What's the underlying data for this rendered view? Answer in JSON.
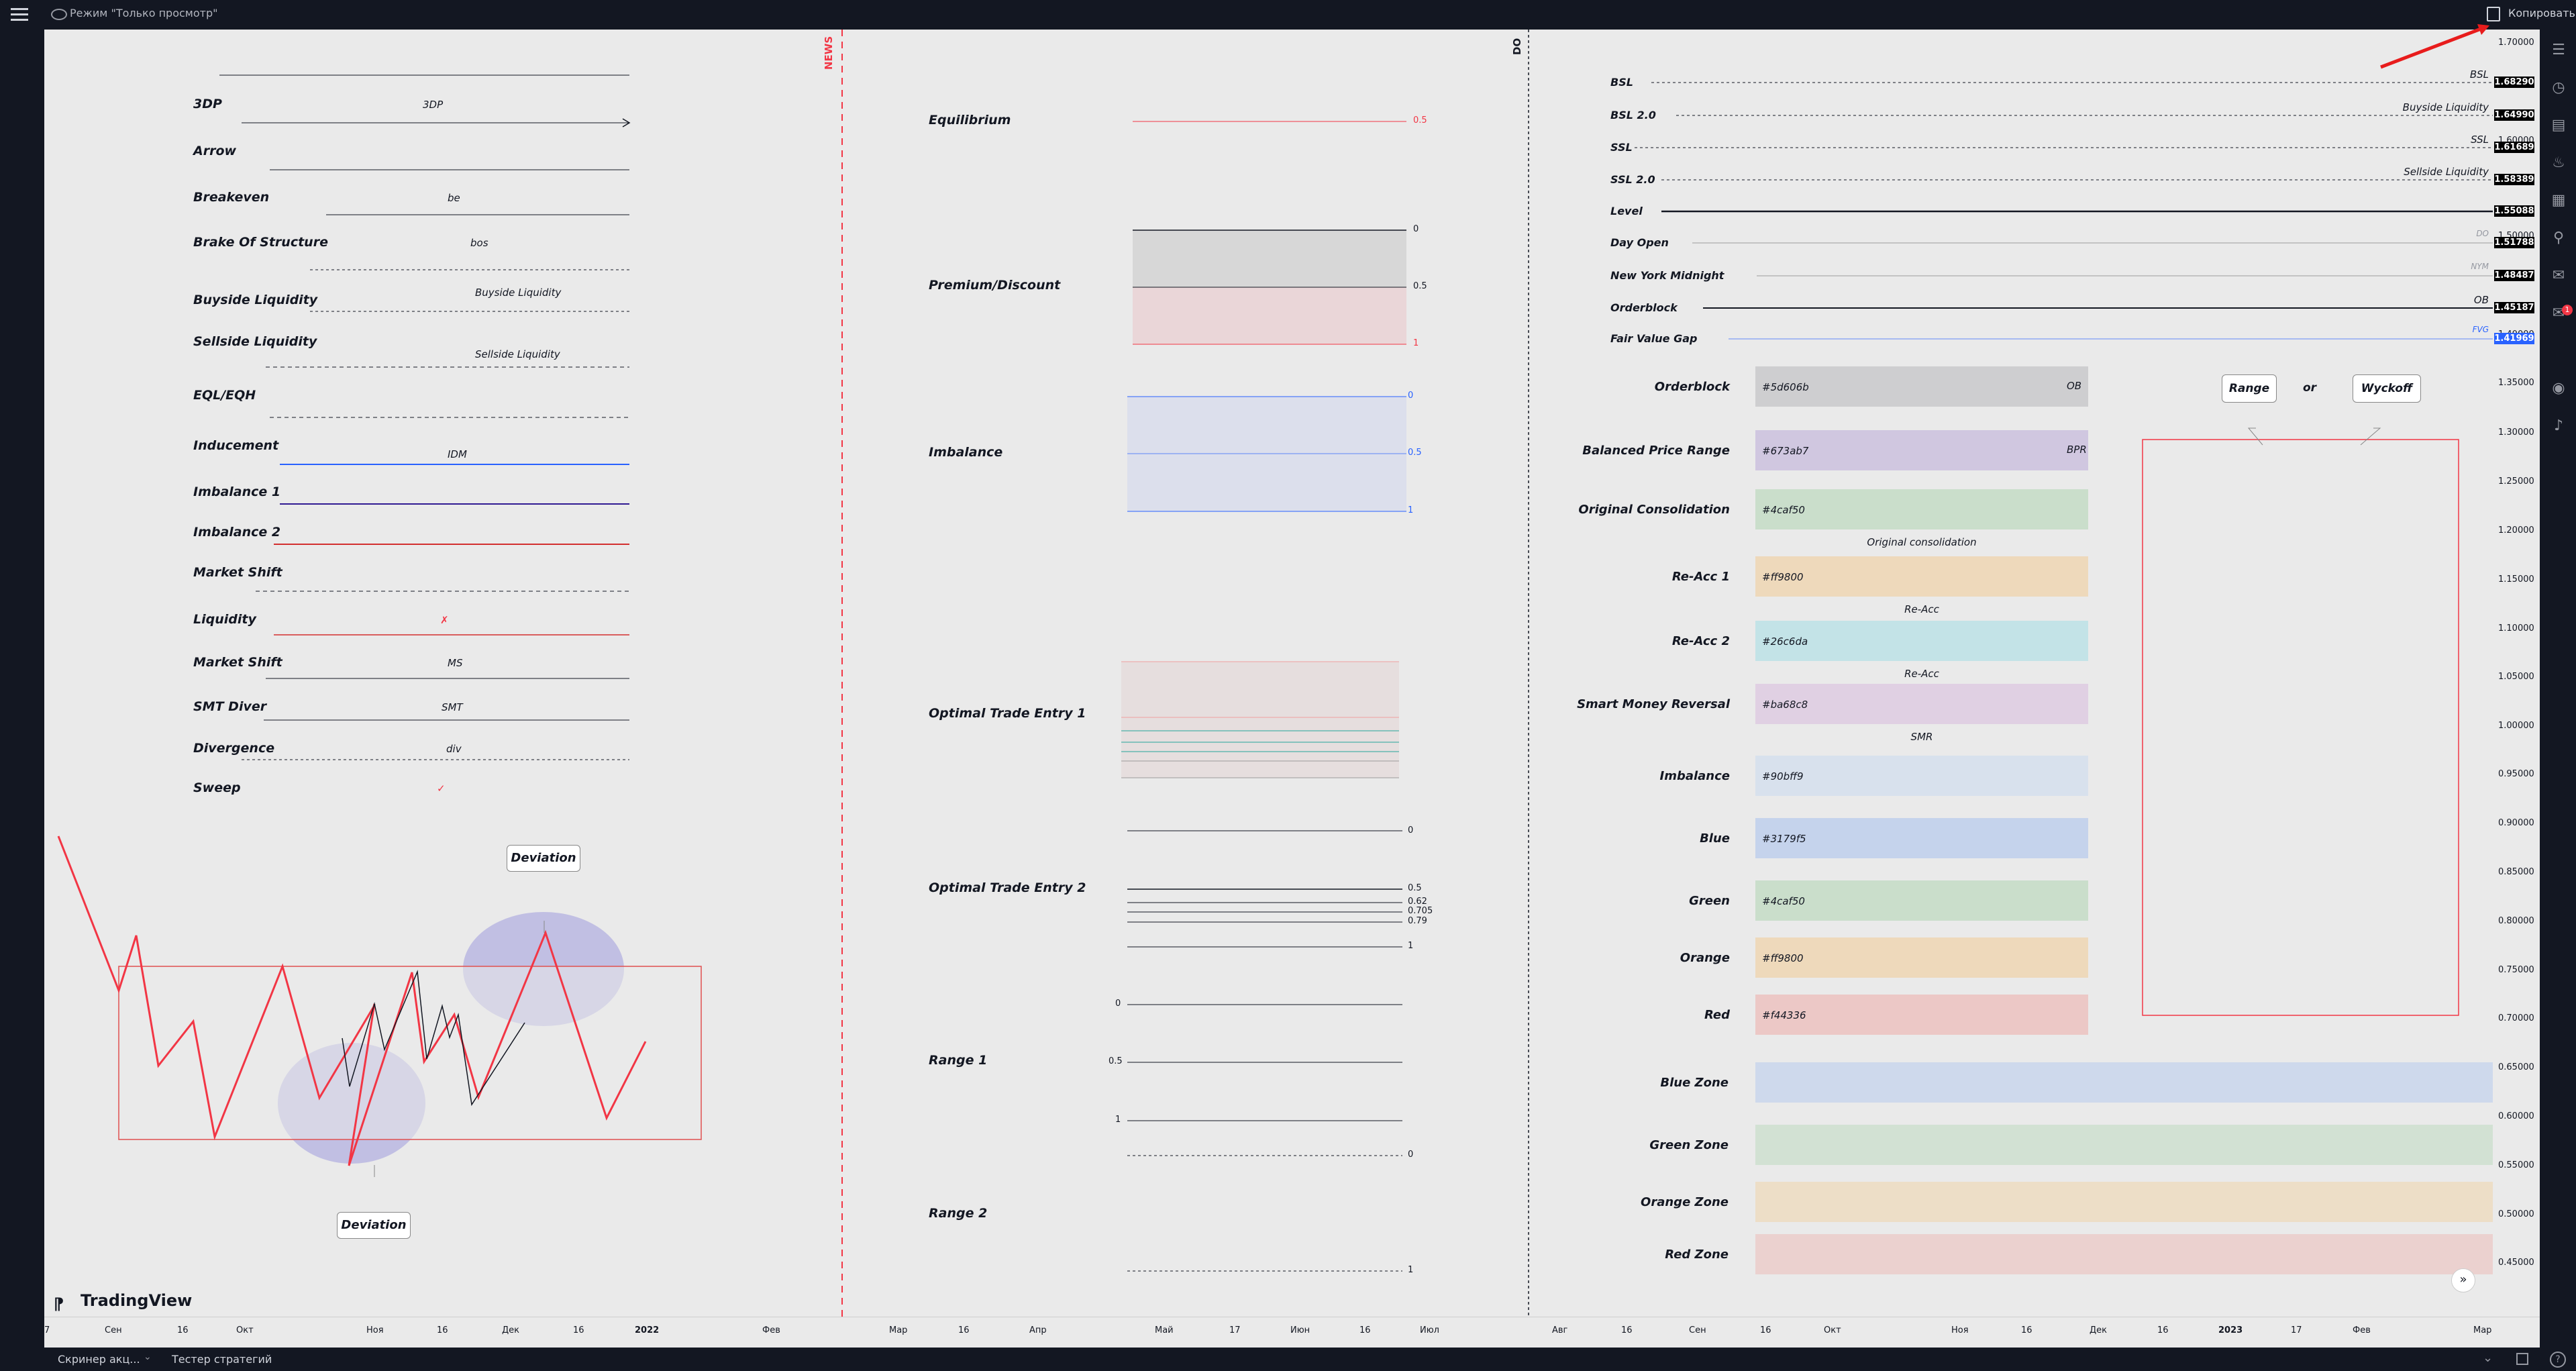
{
  "topbar": {
    "menu_icon": "hamburger-icon",
    "view_mode_icon": "eye-icon",
    "view_mode_label": "Режим \"Только просмотр\"",
    "copy_icon": "copy-icon",
    "copy_label": "Копировать"
  },
  "bottombar": {
    "screener_label": "Скринер акц...",
    "strategy_tester_label": "Тестер стратегий"
  },
  "logo": {
    "text": "TradingView"
  },
  "legend_left": [
    {
      "label": "3DP",
      "tag": "3DP"
    },
    {
      "label": "Arrow",
      "tag": ""
    },
    {
      "label": "Breakeven",
      "tag": "be"
    },
    {
      "label": "Brake Of Structure",
      "tag": "bos"
    },
    {
      "label": "Buyside Liquidity",
      "tag": "Buyside Liquidity"
    },
    {
      "label": "Sellside Liquidity",
      "tag": "Sellside Liquidity"
    },
    {
      "label": "EQL/EQH",
      "tag": ""
    },
    {
      "label": "Inducement",
      "tag": "IDM"
    },
    {
      "label": "Imbalance 1",
      "tag": ""
    },
    {
      "label": "Imbalance 2",
      "tag": ""
    },
    {
      "label": "Market Shift",
      "tag": ""
    },
    {
      "label": "Liquidity",
      "tag": "✗"
    },
    {
      "label": "Market Shift",
      "tag": "MS"
    },
    {
      "label": "SMT Diver",
      "tag": "SMT"
    },
    {
      "label": "Divergence",
      "tag": "div"
    },
    {
      "label": "Sweep",
      "tag": "✓"
    }
  ],
  "deviation": {
    "top_label": "Deviation",
    "bottom_label": "Deviation"
  },
  "vertical_markers": {
    "news": "NEWS",
    "do": "DO"
  },
  "fib_section": {
    "equilibrium": {
      "label": "Equilibrium",
      "level": "0.5"
    },
    "premium_discount": {
      "label": "Premium/Discount",
      "levels": [
        "0",
        "0.5",
        "1"
      ]
    },
    "imbalance": {
      "label": "Imbalance",
      "levels": [
        "0",
        "0.5",
        "1"
      ]
    },
    "ote1": {
      "label": "Optimal Trade Entry 1"
    },
    "ote2": {
      "label": "Optimal Trade Entry 2",
      "levels": [
        "0",
        "0.5",
        "0.62",
        "0.705",
        "0.79",
        "1"
      ]
    },
    "range1": {
      "label": "Range 1",
      "levels": [
        "0",
        "0.5",
        "1"
      ]
    },
    "range2": {
      "label": "Range 2",
      "levels": [
        "0",
        "1"
      ]
    }
  },
  "right_lines": [
    {
      "label": "BSL",
      "tag": "BSL",
      "price": "1.68290"
    },
    {
      "label": "BSL 2.0",
      "tag": "Buyside Liquidity",
      "price": "1.64990"
    },
    {
      "label": "SSL",
      "tag": "SSL",
      "price": "1.61689"
    },
    {
      "label": "SSL 2.0",
      "tag": "Sellside Liquidity",
      "price": "1.58389"
    },
    {
      "label": "Level",
      "tag": "",
      "price": "1.55088"
    },
    {
      "label": "Day Open",
      "tag": "DO",
      "price": "1.51788"
    },
    {
      "label": "New York Midnight",
      "tag": "NYM",
      "price": "1.48487"
    },
    {
      "label": "Orderblock",
      "tag": "OB",
      "price": "1.45187"
    },
    {
      "label": "Fair Value Gap",
      "tag": "FVG",
      "price": "1.41969"
    }
  ],
  "boxes": [
    {
      "label": "Orderblock",
      "hex": "#5d606b",
      "tag": "OB",
      "below": "",
      "color": "#5d606b"
    },
    {
      "label": "Balanced Price Range",
      "hex": "#673ab7",
      "tag": "BPR",
      "below": "",
      "color": "#673ab7"
    },
    {
      "label": "Original Consolidation",
      "hex": "#4caf50",
      "tag": "",
      "below": "Original consolidation",
      "color": "#4caf50"
    },
    {
      "label": "Re-Acc 1",
      "hex": "#ff9800",
      "tag": "",
      "below": "Re-Acc",
      "color": "#ff9800"
    },
    {
      "label": "Re-Acc 2",
      "hex": "#26c6da",
      "tag": "",
      "below": "Re-Acc",
      "color": "#26c6da"
    },
    {
      "label": "Smart Money Reversal",
      "hex": "#ba68c8",
      "tag": "",
      "below": "SMR",
      "color": "#ba68c8"
    },
    {
      "label": "Imbalance",
      "hex": "#90bff9",
      "tag": "",
      "below": "",
      "color": "#90bff9"
    },
    {
      "label": "Blue",
      "hex": "#3179f5",
      "tag": "",
      "below": "",
      "color": "#3179f5"
    },
    {
      "label": "Green",
      "hex": "#4caf50",
      "tag": "",
      "below": "",
      "color": "#4caf50"
    },
    {
      "label": "Orange",
      "hex": "#ff9800",
      "tag": "",
      "below": "",
      "color": "#ff9800"
    },
    {
      "label": "Red",
      "hex": "#f44336",
      "tag": "",
      "below": "",
      "color": "#f44336"
    }
  ],
  "zones": [
    {
      "label": "Blue Zone",
      "color": "#3179f5"
    },
    {
      "label": "Green Zone",
      "color": "#4caf50"
    },
    {
      "label": "Orange Zone",
      "color": "#ff9800"
    },
    {
      "label": "Red Zone",
      "color": "#f44336"
    }
  ],
  "range_wyckoff": {
    "range": "Range",
    "or": "or",
    "wyckoff": "Wyckoff"
  },
  "price_axis": [
    "1.70000",
    "1.60000",
    "1.50000",
    "1.40000",
    "1.35000",
    "1.30000",
    "1.25000",
    "1.20000",
    "1.15000",
    "1.10000",
    "1.05000",
    "1.00000",
    "0.95000",
    "0.90000",
    "0.85000",
    "0.80000",
    "0.75000",
    "0.70000",
    "0.65000",
    "0.60000",
    "0.55000",
    "0.50000",
    "0.45000"
  ],
  "time_axis": [
    "7",
    "Сен",
    "16",
    "Окт",
    "Ноя",
    "16",
    "Дек",
    "16",
    "2022",
    "Фев",
    "Мар",
    "16",
    "Апр",
    "Май",
    "17",
    "Июн",
    "16",
    "Июл",
    "Авг",
    "16",
    "Сен",
    "16",
    "Окт",
    "Ноя",
    "16",
    "Дек",
    "16",
    "2023",
    "17",
    "Фев",
    "Мар"
  ],
  "right_toolbar_icons": [
    "watchlist-icon",
    "alert-clock-icon",
    "data-window-icon",
    "hotlist-fire-icon",
    "calendar-grid-icon",
    "ideas-bulb-icon",
    "chat-icon",
    "notifications-badge-icon",
    "broadcast-icon",
    "bell-icon"
  ],
  "notification_count": "1",
  "colors": {
    "accent_red": "#f23645",
    "fvg_blue": "#2962ff",
    "tv_dark": "#131722"
  }
}
